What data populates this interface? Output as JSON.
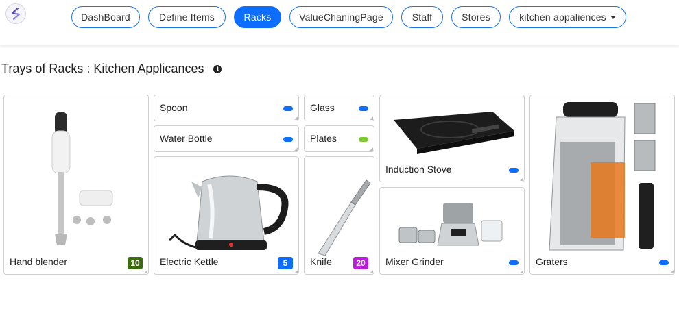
{
  "nav": {
    "items": [
      {
        "label": "DashBoard",
        "active": false
      },
      {
        "label": "Define Items",
        "active": false
      },
      {
        "label": "Racks",
        "active": true
      },
      {
        "label": "ValueChaningPage",
        "active": false
      },
      {
        "label": "Staff",
        "active": false
      },
      {
        "label": "Stores",
        "active": false
      },
      {
        "label": "kitchen appaliences",
        "active": false,
        "dropdown": true
      }
    ]
  },
  "page": {
    "title": "Trays of Racks : Kitchen Applicances",
    "info_icon": "info-circle-icon"
  },
  "trays": [
    {
      "name": "Hand blender",
      "count": "10",
      "badge_color": "#3d6b0f",
      "image": "hand-blender-image"
    },
    {
      "name": "Spoon",
      "indicator_color": "#0d6efd"
    },
    {
      "name": "Water Bottle",
      "indicator_color": "#0d6efd"
    },
    {
      "name": "Electric Kettle",
      "count": "5",
      "badge_color": "#0d6efd",
      "image": "electric-kettle-image"
    },
    {
      "name": "Glass",
      "indicator_color": "#0d6efd"
    },
    {
      "name": "Plates",
      "indicator_color": "#7cc832"
    },
    {
      "name": "Knife",
      "count": "20",
      "badge_color": "#b81fd6",
      "image": "knife-image"
    },
    {
      "name": "Induction Stove",
      "indicator_color": "#0d6efd",
      "image": "induction-stove-image"
    },
    {
      "name": "Mixer Grinder",
      "indicator_color": "#0d6efd",
      "image": "mixer-grinder-image"
    },
    {
      "name": "Graters",
      "indicator_color": "#0d6efd",
      "image": "grater-image"
    }
  ]
}
